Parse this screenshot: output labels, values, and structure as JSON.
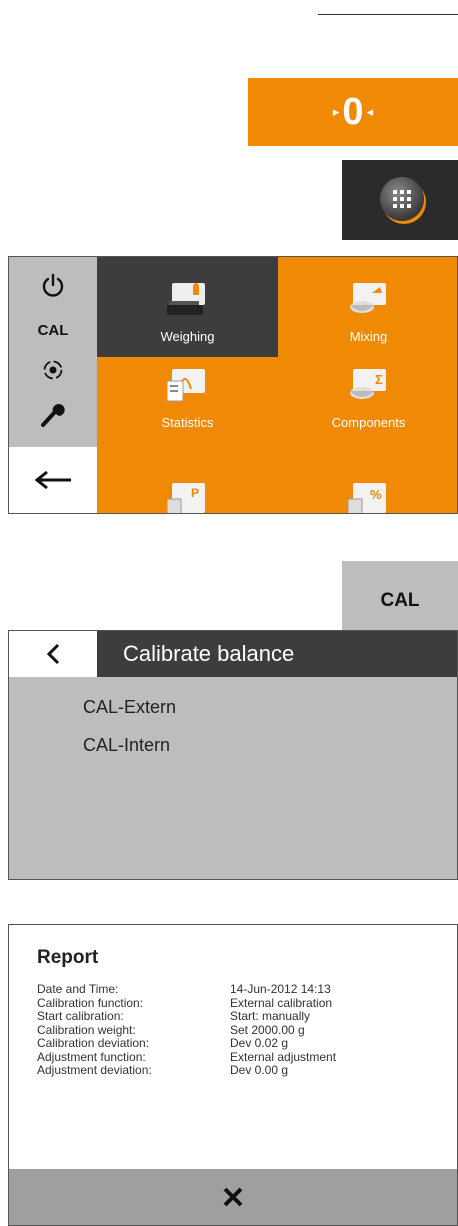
{
  "tare": {
    "value": "0",
    "left_marker": "▸",
    "right_marker": "◂"
  },
  "menu_button": {
    "icon": "grid-icon"
  },
  "sidebar": {
    "items": [
      {
        "icon": "power-icon"
      },
      {
        "label": "CAL"
      },
      {
        "icon": "level-icon"
      },
      {
        "icon": "wrench-icon"
      },
      {
        "icon": "back-arrow-icon"
      }
    ]
  },
  "apps": [
    {
      "label": "Weighing",
      "icon": "weighing-icon",
      "selected": true
    },
    {
      "label": "Mixing",
      "icon": "mixing-icon"
    },
    {
      "label": "Statistics",
      "icon": "statistics-icon"
    },
    {
      "label": "Components",
      "icon": "components-icon"
    },
    {
      "label": "",
      "icon": "density-icon"
    },
    {
      "label": "",
      "icon": "percent-icon"
    }
  ],
  "cal_button": {
    "label": "CAL"
  },
  "calibrate": {
    "title": "Calibrate balance",
    "options": [
      "CAL-Extern",
      "CAL-Intern"
    ]
  },
  "report": {
    "title": "Report",
    "rows": [
      {
        "key": "Date and Time:",
        "value": "14-Jun-2012   14:13"
      },
      {
        "key": "Calibration function:",
        "value": "External calibration"
      },
      {
        "key": "Start calibration:",
        "value": "Start: manually"
      },
      {
        "key": "Calibration weight:",
        "value": "Set 2000.00 g"
      },
      {
        "key": "Calibration deviation:",
        "value": "Dev 0.02 g"
      },
      {
        "key": "Adjustment function:",
        "value": "External adjustment"
      },
      {
        "key": "Adjustment deviation:",
        "value": "Dev 0.00 g"
      }
    ],
    "close_icon": "close-icon"
  },
  "colors": {
    "accent": "#f08a05",
    "dark": "#3d3d3d",
    "panel_gray": "#bdbdbd"
  }
}
